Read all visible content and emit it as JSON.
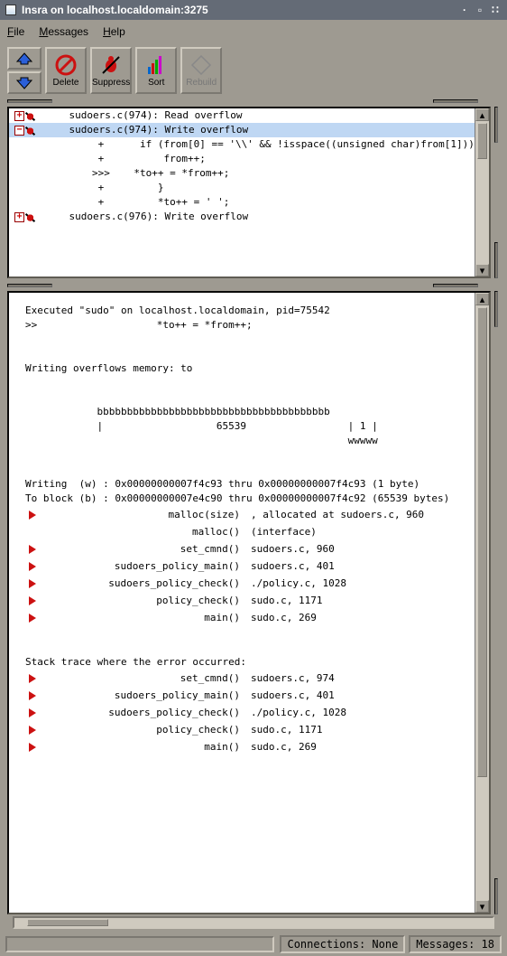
{
  "title": "Insra on localhost.localdomain:3275",
  "menu": {
    "file": "File",
    "messages": "Messages",
    "help": "Help"
  },
  "toolbar": {
    "delete": "Delete",
    "suppress": "Suppress",
    "sort": "Sort",
    "rebuild": "Rebuild"
  },
  "errors": [
    {
      "kind": "plus",
      "text": "sudoers.c(974): Read overflow",
      "selected": false
    },
    {
      "kind": "minus",
      "text": "sudoers.c(974): Write overflow",
      "selected": true
    },
    {
      "kind": "plus",
      "text": "sudoers.c(976): Write overflow",
      "selected": false
    }
  ],
  "code_context": [
    {
      "marker": " +",
      "text": "    if (from[0] == '\\\\' && !isspace((unsigned char)from[1]))"
    },
    {
      "marker": " +",
      "text": "        from++;"
    },
    {
      "marker": ">>>",
      "text": "   *to++ = *from++;"
    },
    {
      "marker": " +",
      "text": "       }"
    },
    {
      "marker": " +",
      "text": "       *to++ = ' ';"
    }
  ],
  "details": {
    "executed": "Executed \"sudo\" on localhost.localdomain, pid=75542",
    "focus_marker": ">>",
    "focus_code": "*to++ = *from++;",
    "overflow_msg": "Writing overflows memory: to",
    "diagram_bar": "bbbbbbbbbbbbbbbbbbbbbbbbbbbbbbbbbbbbbbb",
    "diagram_mid": "|                   65539                 | 1 |",
    "diagram_end": "                                          wwwww",
    "writing_line": "Writing  (w) : 0x00000000007f4c93 thru 0x00000000007f4c93 (1 byte)",
    "toblock_line": "To block (b) : 0x00000000007e4c90 thru 0x00000000007f4c92 (65539 bytes)",
    "alloc_trace": [
      {
        "fn": "malloc(size)",
        "loc": ", allocated at sudoers.c, 960",
        "tri": true
      },
      {
        "fn": "malloc()",
        "loc": "(interface)",
        "tri": false
      },
      {
        "fn": "set_cmnd()",
        "loc": "sudoers.c, 960",
        "tri": true
      },
      {
        "fn": "sudoers_policy_main()",
        "loc": "sudoers.c, 401",
        "tri": true
      },
      {
        "fn": "sudoers_policy_check()",
        "loc": "./policy.c, 1028",
        "tri": true
      },
      {
        "fn": "policy_check()",
        "loc": "sudo.c, 1171",
        "tri": true
      },
      {
        "fn": "main()",
        "loc": "sudo.c, 269",
        "tri": true
      }
    ],
    "stack_header": "Stack trace where the error occurred:",
    "stack_trace": [
      {
        "fn": "set_cmnd()",
        "loc": "sudoers.c, 974",
        "tri": true
      },
      {
        "fn": "sudoers_policy_main()",
        "loc": "sudoers.c, 401",
        "tri": true
      },
      {
        "fn": "sudoers_policy_check()",
        "loc": "./policy.c, 1028",
        "tri": true
      },
      {
        "fn": "policy_check()",
        "loc": "sudo.c, 1171",
        "tri": true
      },
      {
        "fn": "main()",
        "loc": "sudo.c, 269",
        "tri": true
      }
    ]
  },
  "status": {
    "connections": "Connections: None",
    "messages": "Messages: 18"
  }
}
